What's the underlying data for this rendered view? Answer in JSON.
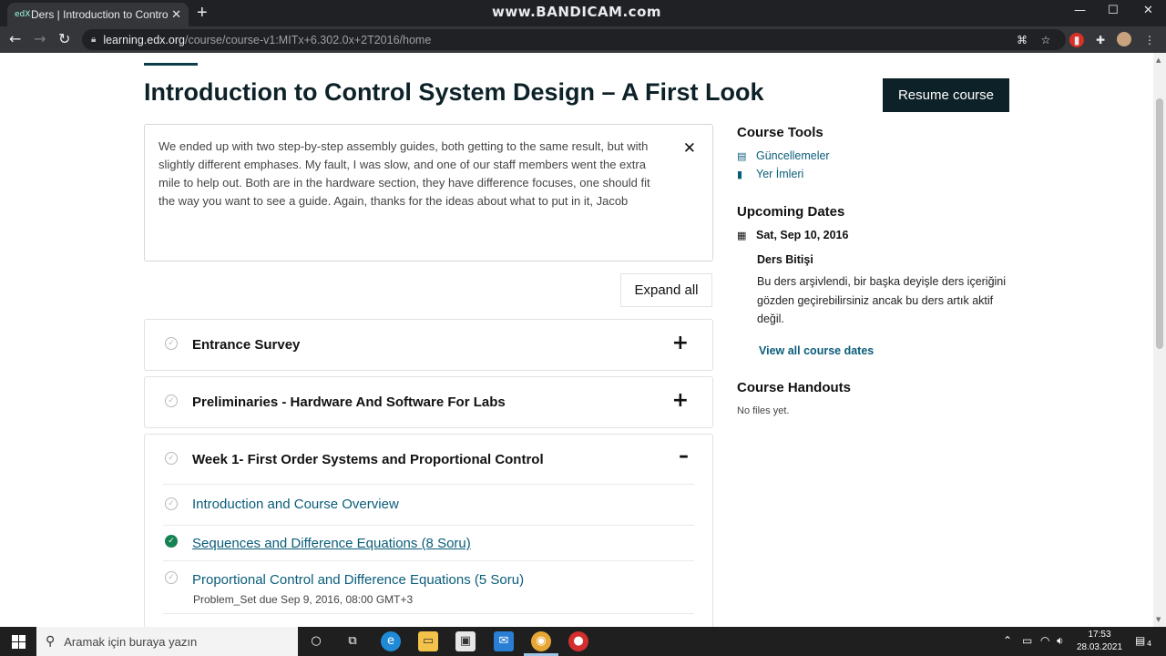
{
  "browser": {
    "tab_favicon": "edX",
    "tab_title": "Ders | Introduction to Control Sys",
    "new_tab": "+",
    "watermark": "www.BANDICAM.com",
    "url_host": "learning.edx.org",
    "url_path": "/course/course-v1:MITx+6.302.0x+2T2016/home",
    "window_controls": [
      "minimize-icon",
      "maximize-icon",
      "close-icon"
    ]
  },
  "course": {
    "title": "Introduction to Control System Design – A First Look",
    "resume_label": "Resume course",
    "expand_all_label": "Expand all"
  },
  "notice": {
    "text": "We ended up with two step-by-step assembly guides, both getting to the same result, but with slightly different emphases. My fault, I was slow, and one of our staff members went the extra mile to help out. Both are in the hardware section, they have difference focuses, one should fit the way you want to see a guide. Again, thanks for the ideas about what to put in it, Jacob"
  },
  "sections": [
    {
      "title": "Entrance Survey",
      "toggle": "+"
    },
    {
      "title": "Preliminaries - Hardware And Software For Labs",
      "toggle": "+"
    },
    {
      "title": "Week 1- First Order Systems and Proportional Control",
      "toggle": "–"
    }
  ],
  "subsections": [
    {
      "title": "Introduction and Course Overview",
      "completed": false
    },
    {
      "title": "Sequences and Difference Equations (8 Soru)",
      "completed": true
    },
    {
      "title": "Proportional Control and Difference Equations (5 Soru)",
      "completed": false,
      "meta": "Problem_Set due Sep 9, 2016, 08:00 GMT+3"
    }
  ],
  "sidebar": {
    "tools_heading": "Course Tools",
    "tools": [
      "Güncellemeler",
      "Yer İmleri"
    ],
    "dates_heading": "Upcoming Dates",
    "date": "Sat, Sep 10, 2016",
    "date_label": "Ders Bitişi",
    "date_desc": "Bu ders arşivlendi, bir başka deyişle ders içeriğini gözden geçirebilirsiniz ancak bu ders artık aktif değil.",
    "view_dates": "View all course dates",
    "handouts_heading": "Course Handouts",
    "handouts_empty": "No files yet."
  },
  "taskbar": {
    "search_placeholder": "Aramak için buraya yazın",
    "time": "17:53",
    "date": "28.03.2021",
    "notification_count": "4"
  }
}
